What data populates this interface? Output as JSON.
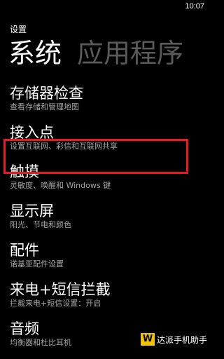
{
  "status_bar": {
    "time": "10:07"
  },
  "app": {
    "title": "设置"
  },
  "pivot": {
    "tabs": [
      {
        "label": "系统",
        "active": true
      },
      {
        "label": "应用程序",
        "active": false
      }
    ]
  },
  "settings": {
    "items": [
      {
        "title": "存储器检查",
        "subtitle": "查看存储和管理地图"
      },
      {
        "title": "接入点",
        "subtitle": "设置互联网、彩信和互联网共享"
      },
      {
        "title": "触摸",
        "subtitle": "灵敏度、唤醒和 Windows 键",
        "highlighted": true
      },
      {
        "title": "显示屏",
        "subtitle": "阳光、节电和颜色"
      },
      {
        "title": "配件",
        "subtitle": "诺基亚配件设置"
      },
      {
        "title": "来电+短信拦截",
        "subtitle": "拦截来电+短信设置：开启"
      },
      {
        "title": "音频",
        "subtitle": "均衡器和杜比耳机"
      }
    ]
  },
  "colors": {
    "highlight_border": "#e31b23",
    "subtitle_text": "#a6a6a6",
    "inactive_tab": "#5a5a5a"
  },
  "watermark": {
    "logo": "W",
    "text": "达派手机助手"
  }
}
